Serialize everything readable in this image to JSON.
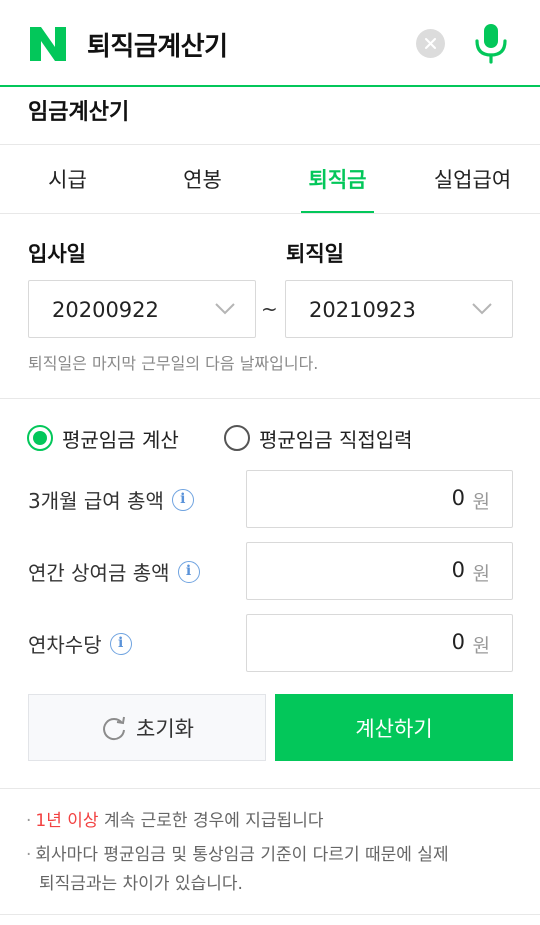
{
  "header": {
    "logo": "N",
    "query": "퇴직금계산기",
    "clear_icon": "close-icon",
    "mic_icon": "microphone-icon"
  },
  "calculator": {
    "title": "임금계산기",
    "tabs": [
      {
        "label": "시급",
        "active": false
      },
      {
        "label": "연봉",
        "active": false
      },
      {
        "label": "퇴직금",
        "active": true
      },
      {
        "label": "실업급여",
        "active": false
      }
    ],
    "join_date": {
      "label": "입사일",
      "value": "20200922"
    },
    "leave_date": {
      "label": "퇴직일",
      "value": "20210923"
    },
    "range_separator": "~",
    "date_note": "퇴직일은 마지막 근무일의 다음 날짜입니다.",
    "mode_options": [
      {
        "label": "평균임금 계산",
        "selected": true
      },
      {
        "label": "평균임금 직접입력",
        "selected": false
      }
    ],
    "fields": [
      {
        "label": "3개월 급여 총액",
        "value": "0",
        "unit": "원"
      },
      {
        "label": "연간 상여금 총액",
        "value": "0",
        "unit": "원"
      },
      {
        "label": "연차수당",
        "value": "0",
        "unit": "원"
      }
    ],
    "info_glyph": "i",
    "reset_label": "초기화",
    "calculate_label": "계산하기",
    "notes": {
      "line1_highlight": "1년 이상",
      "line1_rest": " 계속 근로한 경우에 지급됩니다",
      "line2_a": "회사마다 평균임금 및 통상임금 기준이 다르기 때문에 실제",
      "line2_b": "퇴직금과는 차이가 있습니다.",
      "bullet": "·"
    }
  },
  "colors": {
    "accent": "#03c75a",
    "highlight": "#f24141",
    "info": "#5b93d9"
  }
}
